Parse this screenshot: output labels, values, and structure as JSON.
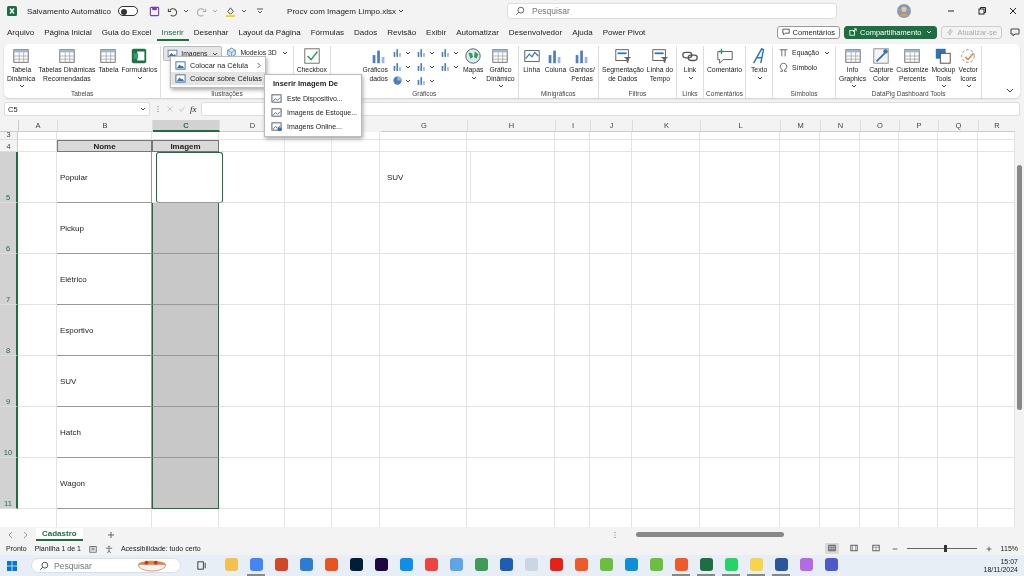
{
  "titlebar": {
    "autosave": {
      "label": "Salvamento Automático",
      "on": false
    },
    "file_name": "Procv com Imagem Limpo.xlsx",
    "search": {
      "placeholder": "Pesquisar"
    }
  },
  "menu_tabs": [
    {
      "label": "Arquivo",
      "selected": false
    },
    {
      "label": "Página Inicial",
      "selected": false
    },
    {
      "label": "Guia do Excel",
      "selected": false
    },
    {
      "label": "Inserir",
      "selected": true
    },
    {
      "label": "Desenhar",
      "selected": false
    },
    {
      "label": "Layout da Página",
      "selected": false
    },
    {
      "label": "Fórmulas",
      "selected": false
    },
    {
      "label": "Dados",
      "selected": false
    },
    {
      "label": "Revisão",
      "selected": false
    },
    {
      "label": "Exibir",
      "selected": false
    },
    {
      "label": "Automatizar",
      "selected": false
    },
    {
      "label": "Desenvolvedor",
      "selected": false
    },
    {
      "label": "Ajuda",
      "selected": false
    },
    {
      "label": "Power Pivot",
      "selected": false
    }
  ],
  "header_actions": {
    "comments": "Comentários",
    "share": "Compartilhamento",
    "update": {
      "label": "Atualizar-se",
      "disabled": true
    }
  },
  "ribbon_groups": [
    {
      "label": "Tabelas",
      "columns": [
        [
          {
            "kind": "large",
            "lines": [
              "Tabela",
              "Dinâmica"
            ],
            "dropdown": true
          }
        ],
        [
          {
            "kind": "large",
            "lines": [
              "Tabelas Dinâmicas",
              "Recomendadas"
            ]
          }
        ],
        [
          {
            "kind": "large",
            "lines": [
              "Tabela"
            ]
          }
        ],
        [
          {
            "kind": "large",
            "lines": [
              "Formulários"
            ],
            "dropdown": true
          }
        ]
      ]
    },
    {
      "label": "Ilustrações",
      "columns": [
        [
          {
            "kind": "small",
            "label": "Imagens",
            "dropdown": true,
            "selected": true
          }
        ],
        [
          {
            "kind": "small",
            "label": "Modelos 3D",
            "dropdown": true,
            "selected": false
          }
        ]
      ]
    },
    {
      "columns": [
        [
          {
            "kind": "large",
            "lines": [
              "Checkbox"
            ]
          }
        ]
      ]
    },
    {
      "label": "Gráficos",
      "columns": [
        [
          {
            "kind": "large",
            "lines": [
              "Gráficos",
              "dados"
            ]
          }
        ],
        [
          {
            "kind": "mini",
            "dropdown": true
          },
          {
            "kind": "mini",
            "dropdown": true
          },
          {
            "kind": "mini",
            "dropdown": true
          }
        ],
        [
          {
            "kind": "mini",
            "dropdown": true
          },
          {
            "kind": "mini",
            "dropdown": true
          },
          {
            "kind": "mini",
            "dropdown": true
          }
        ],
        [
          {
            "kind": "mini",
            "dropdown": true
          },
          {
            "kind": "mini",
            "dropdown": true
          }
        ],
        [
          {
            "kind": "large",
            "lines": [
              "Mapas"
            ],
            "dropdown": true
          }
        ],
        [
          {
            "kind": "large",
            "lines": [
              "Gráfico",
              "Dinâmico"
            ],
            "dropdown": true
          }
        ]
      ]
    },
    {
      "label": "Minigráficos",
      "columns": [
        [
          {
            "kind": "large",
            "lines": [
              "Linha"
            ]
          }
        ],
        [
          {
            "kind": "large",
            "lines": [
              "Coluna"
            ]
          }
        ],
        [
          {
            "kind": "large",
            "lines": [
              "Ganhos/",
              "Perdas"
            ]
          }
        ]
      ]
    },
    {
      "label": "Filtros",
      "columns": [
        [
          {
            "kind": "large",
            "lines": [
              "Segmentação",
              "de Dados"
            ]
          }
        ],
        [
          {
            "kind": "large",
            "lines": [
              "Linha do",
              "Tempo"
            ]
          }
        ]
      ]
    },
    {
      "label": "Links",
      "columns": [
        [
          {
            "kind": "large",
            "lines": [
              "Link"
            ],
            "dropdown": true
          }
        ]
      ]
    },
    {
      "label": "Comentários",
      "columns": [
        [
          {
            "kind": "large",
            "lines": [
              "Comentário"
            ]
          }
        ]
      ]
    },
    {
      "columns": [
        [
          {
            "kind": "large",
            "lines": [
              "Texto"
            ],
            "dropdown": true
          }
        ]
      ]
    },
    {
      "label": "Símbolos",
      "columns": [
        [
          {
            "kind": "small",
            "label": "Equação",
            "dropdown": true,
            "selected": false
          },
          {
            "kind": "small",
            "label": "Símbolo",
            "selected": false
          }
        ]
      ]
    },
    {
      "label": "DataPig Dashboard Tools",
      "columns": [
        [
          {
            "kind": "large",
            "lines": [
              "Info",
              "Graphics"
            ],
            "dropdown": true
          }
        ],
        [
          {
            "kind": "large",
            "lines": [
              "Capture",
              "Color"
            ]
          }
        ],
        [
          {
            "kind": "large",
            "lines": [
              "Customize",
              "Percents"
            ]
          }
        ],
        [
          {
            "kind": "large",
            "lines": [
              "Mockup",
              "Tools"
            ],
            "dropdown": true
          }
        ],
        [
          {
            "kind": "large",
            "lines": [
              "Vector",
              "Icons"
            ],
            "dropdown": true
          }
        ]
      ]
    }
  ],
  "image_menu": {
    "items": [
      {
        "label": "Colocar na Célula",
        "selected": false
      },
      {
        "label": "Colocar sobre Células",
        "selected": true
      }
    ]
  },
  "submenu": {
    "title": "Inserir Imagem De",
    "items": [
      "Este Dispositivo...",
      "Imagens de Estoque...",
      "Imagens Online..."
    ]
  },
  "formula_bar": {
    "name_box": "C5",
    "function_label": "fx"
  },
  "sheet": {
    "columns": [
      {
        "label": "A",
        "selected": false
      },
      {
        "label": "B",
        "selected": false
      },
      {
        "label": "C",
        "selected": true
      },
      {
        "label": "D",
        "selected": false
      },
      {
        "label": "G",
        "selected": false
      },
      {
        "label": "H",
        "selected": false
      },
      {
        "label": "I",
        "selected": false
      },
      {
        "label": "J",
        "selected": false
      },
      {
        "label": "K",
        "selected": false
      },
      {
        "label": "L",
        "selected": false
      },
      {
        "label": "M",
        "selected": false
      },
      {
        "label": "N",
        "selected": false
      },
      {
        "label": "O",
        "selected": false
      },
      {
        "label": "P",
        "selected": false
      },
      {
        "label": "Q",
        "selected": false
      },
      {
        "label": "R",
        "selected": false
      }
    ],
    "rows": [
      {
        "number": "3",
        "selected": false
      },
      {
        "number": "4",
        "selected": false,
        "header": true,
        "name": "Nome",
        "image": "Imagem"
      },
      {
        "number": "5",
        "selected": true,
        "name": "Popular",
        "image_selected": true,
        "active": true,
        "column_g": "SUV"
      },
      {
        "number": "6",
        "selected": true,
        "name": "Pickup",
        "image_selected": true,
        "active": false
      },
      {
        "number": "7",
        "selected": true,
        "name": "Elétrico",
        "image_selected": true,
        "active": false
      },
      {
        "number": "8",
        "selected": true,
        "name": "Esportivo",
        "image_selected": true,
        "active": false
      },
      {
        "number": "9",
        "selected": true,
        "name": "SUV",
        "image_selected": true,
        "active": false
      },
      {
        "number": "10",
        "selected": true,
        "name": "Hatch",
        "image_selected": true,
        "active": false
      },
      {
        "number": "11",
        "selected": true,
        "name": "Wagon",
        "image_selected": true,
        "active": false
      }
    ]
  },
  "sheet_tabs": [
    {
      "label": "Cadastro",
      "selected": true
    }
  ],
  "status_bar": {
    "ready": "Pronto",
    "sheet_count": "Planilha 1 de 1",
    "accessibility": "Acessibilidade: tudo certo",
    "views": [
      {
        "selected": true
      },
      {
        "selected": false
      },
      {
        "selected": false
      }
    ],
    "zoom": {
      "level": 0.55,
      "reading": "115%"
    }
  },
  "taskbar": {
    "search_placeholder": "Pesquisar",
    "apps": [
      {
        "color": "#f2c14e",
        "running": false
      },
      {
        "color": "#4285f4",
        "running": true
      },
      {
        "color": "#d24726",
        "running": false
      },
      {
        "color": "#2b7cd3",
        "running": false
      },
      {
        "color": "#e8531f",
        "running": false
      },
      {
        "color": "#001e36",
        "running": false
      },
      {
        "color": "#1f0740",
        "running": false
      },
      {
        "color": "#0e8ee9",
        "running": false
      },
      {
        "color": "#ef443b",
        "running": false
      },
      {
        "color": "#5aa6e8",
        "running": false
      },
      {
        "color": "#3f9b5a",
        "running": false
      },
      {
        "color": "#1a5fb4",
        "running": false
      },
      {
        "color": "#c8d6e5",
        "running": false
      },
      {
        "color": "#e62117",
        "running": false
      },
      {
        "color": "#f05a28",
        "running": false
      },
      {
        "color": "#6cbf3c",
        "running": false
      },
      {
        "color": "#0f8fd8",
        "running": false
      },
      {
        "color": "#6cbf3c",
        "running": false
      },
      {
        "color": "#f05a28",
        "running": true
      },
      {
        "color": "#1d6f42",
        "running": true
      },
      {
        "color": "#25d366",
        "running": true
      },
      {
        "color": "#f7d54a",
        "running": true
      },
      {
        "color": "#2b579a",
        "running": true
      },
      {
        "color": "#b36ae2",
        "running": false
      },
      {
        "color": "#5059c9",
        "running": false
      }
    ],
    "time": "15:07",
    "date": "18/11/2024"
  }
}
